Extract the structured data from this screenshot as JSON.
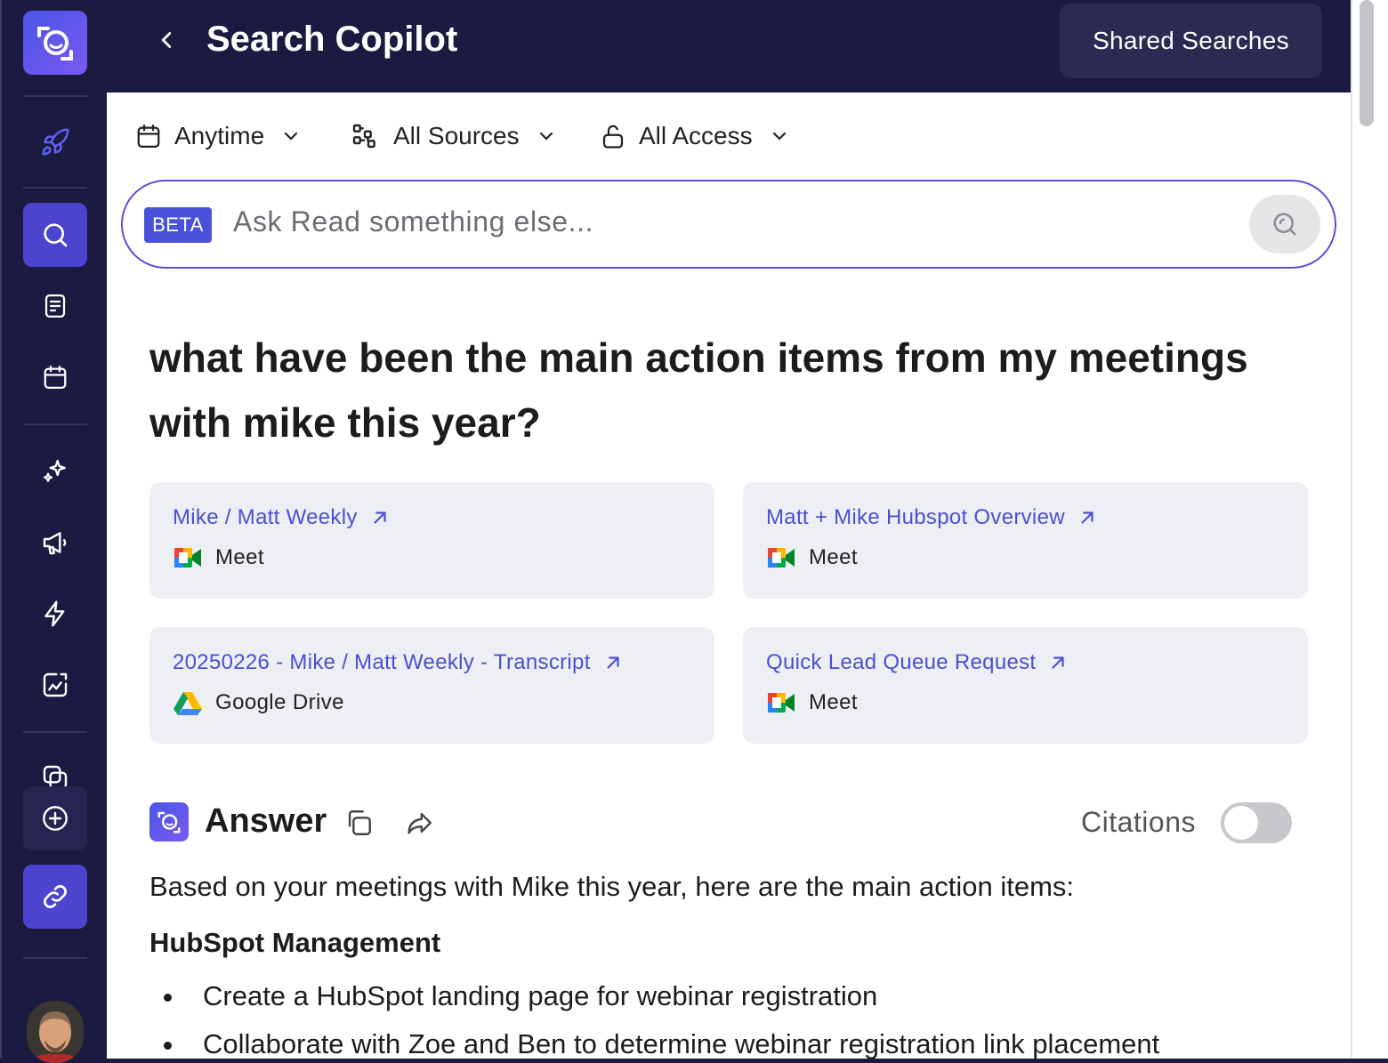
{
  "header": {
    "title": "Search Copilot",
    "shared_searches_label": "Shared Searches"
  },
  "filters": {
    "time": "Anytime",
    "sources": "All Sources",
    "access": "All Access"
  },
  "search": {
    "badge": "BETA",
    "placeholder": "Ask Read something else..."
  },
  "query": "what have been the main action items from my meetings with mike this year?",
  "results": [
    {
      "title": "Mike / Matt Weekly",
      "source": "Meet",
      "source_icon": "google-meet-icon"
    },
    {
      "title": "Matt + Mike Hubspot Overview",
      "source": "Meet",
      "source_icon": "google-meet-icon"
    },
    {
      "title": "20250226 - Mike / Matt Weekly - Transcript",
      "source": "Google Drive",
      "source_icon": "google-drive-icon"
    },
    {
      "title": "Quick Lead Queue Request",
      "source": "Meet",
      "source_icon": "google-meet-icon"
    }
  ],
  "answer": {
    "title": "Answer",
    "citations_label": "Citations",
    "citations_enabled": false,
    "intro": "Based on your meetings with Mike this year, here are the main action items:",
    "section_title": "HubSpot Management",
    "items": [
      "Create a HubSpot landing page for webinar registration",
      "Collaborate with Zoe and Ben to determine webinar registration link placement"
    ]
  },
  "colors": {
    "brand": "#4b44cf",
    "nav_bg": "#1b1a40",
    "link": "#4a50d2",
    "card_bg": "#eeeff5"
  }
}
